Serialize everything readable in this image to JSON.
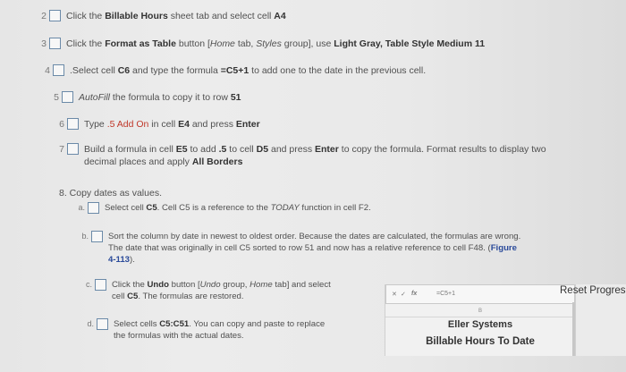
{
  "steps": [
    {
      "num": "2",
      "parts": [
        "Click the ",
        "Billable Hours",
        " sheet tab and select cell ",
        "A4"
      ]
    },
    {
      "num": "3",
      "parts": [
        "Click the ",
        "Format as Table",
        " button [",
        "Home",
        " tab, ",
        "Styles",
        " group], use ",
        "Light Gray, Table Style Medium 11"
      ]
    },
    {
      "num": "4",
      "parts": [
        ".Select cell ",
        "C6",
        " and type the formula ",
        "=C5+1",
        " to add one to the date in the previous cell."
      ]
    },
    {
      "num": "5",
      "parts": [
        "AutoFill",
        " the formula to copy it to row ",
        "51"
      ]
    },
    {
      "num": "6",
      "parts": [
        "Type ",
        ".5 Add On",
        " in cell ",
        "E4",
        " and press ",
        "Enter"
      ]
    },
    {
      "num": "7",
      "line1": [
        "Build a formula in cell ",
        "E5",
        " to add ",
        ".5",
        " to cell ",
        "D5",
        " and press ",
        "Enter",
        " to copy the formula. Format results to display two"
      ],
      "line2": [
        "decimal places and apply ",
        "All Borders"
      ]
    }
  ],
  "step8": {
    "heading": "8. Copy dates as values.",
    "a": {
      "letter": "a.",
      "parts": [
        "Select cell ",
        "C5",
        ". Cell C5 is a reference to the ",
        "TODAY",
        " function in cell F2."
      ]
    },
    "b": {
      "letter": "b.",
      "line1": "Sort the column by date in newest to oldest order. Because the dates are calculated, the formulas are wrong.",
      "line2a": "The date that was originally in cell C5 sorted to row 51 and now has a relative reference to cell F48. (",
      "figure": "Figure",
      "line3": "4-113",
      "line3b": ")."
    },
    "c": {
      "letter": "c.",
      "line1": [
        "Click the ",
        "Undo",
        " button [",
        "Undo",
        " group, ",
        "Home",
        " tab] and select"
      ],
      "line2": [
        "cell ",
        "C5",
        ". The formulas are restored."
      ]
    },
    "d": {
      "letter": "d.",
      "line1": [
        "Select cells ",
        "C5:C51",
        ". You can copy and paste to replace"
      ],
      "line2": "the formulas with the actual dates."
    }
  },
  "excel": {
    "formula": "=C5+1",
    "fx": "fx",
    "column": "B",
    "company": "Eller Systems",
    "title": "Billable Hours To Date"
  },
  "reset_label": "Reset Progres"
}
